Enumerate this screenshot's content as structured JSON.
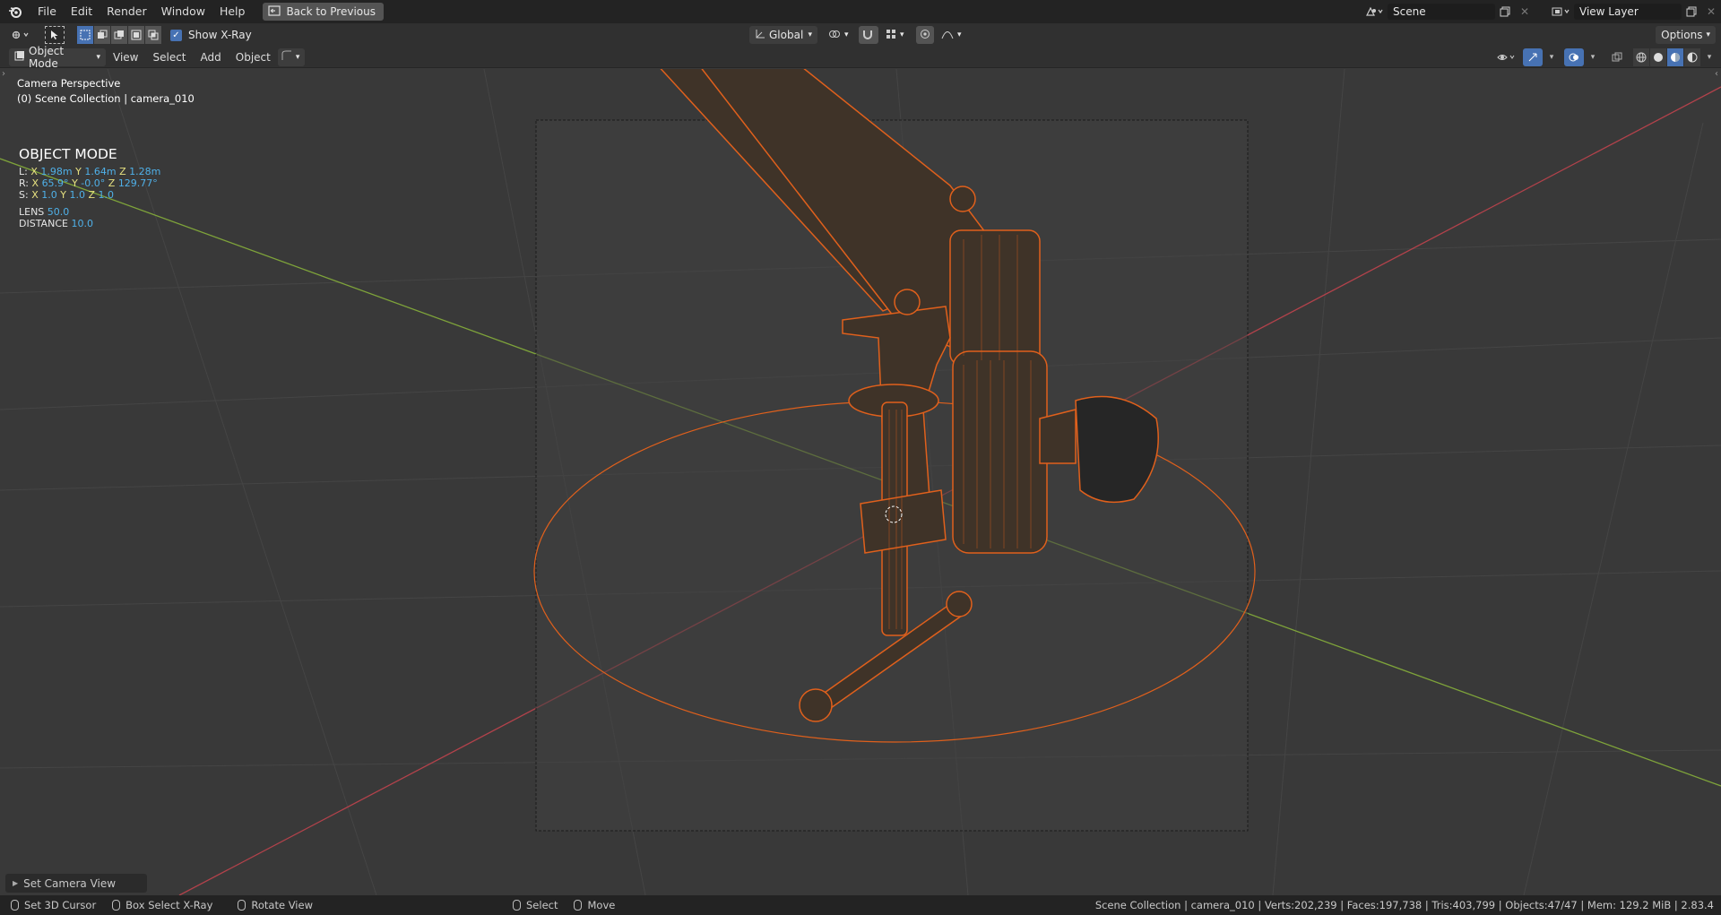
{
  "topbar": {
    "menus": [
      "File",
      "Edit",
      "Render",
      "Window",
      "Help"
    ],
    "back_button": "Back to Previous",
    "scene_name": "Scene",
    "view_layer": "View Layer"
  },
  "toolbar": {
    "show_xray_label": "Show X-Ray",
    "show_xray_checked": true,
    "transform_orientation": "Global",
    "options_label": "Options"
  },
  "header": {
    "mode": "Object Mode",
    "menus": [
      "View",
      "Select",
      "Add",
      "Object"
    ]
  },
  "viewport": {
    "perspective_label": "Camera Perspective",
    "collection_label": "(0) Scene Collection | camera_010",
    "mode_title": "OBJECT MODE",
    "location": {
      "prefix": "L:",
      "x": "1.98m",
      "y": "1.64m",
      "z": "1.28m"
    },
    "rotation": {
      "prefix": "R:",
      "x": "65.9°",
      "y": "-0.0°",
      "z": "129.77°"
    },
    "scale": {
      "prefix": "S:",
      "x": "1.0",
      "y": "1.0",
      "z": "1.0"
    },
    "lens_label": "LENS",
    "lens_value": "50.0",
    "distance_label": "DISTANCE",
    "distance_value": "10.0",
    "axis_x": "X",
    "axis_y": "Y",
    "axis_z": "Z"
  },
  "last_operator": "Set Camera View",
  "statusbar": {
    "hints": [
      {
        "label": "Set 3D Cursor"
      },
      {
        "label": "Box Select X-Ray"
      },
      {
        "label": "Rotate View"
      },
      {
        "label": "Select"
      },
      {
        "label": "Move"
      }
    ],
    "stats": "Scene Collection | camera_010 | Verts:202,239 | Faces:197,738 | Tris:403,799 | Objects:47/47 | Mem: 129.2 MiB | 2.83.4"
  },
  "colors": {
    "selection_orange": "#e0601c",
    "x_axis_red": "#b2424b",
    "y_axis_green": "#7ea33a",
    "accent_blue": "#4772b3"
  }
}
